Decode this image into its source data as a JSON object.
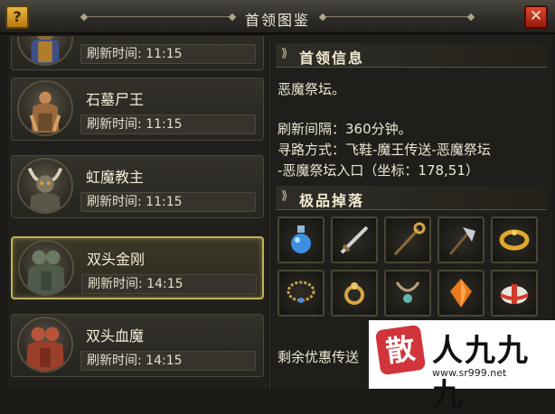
{
  "window": {
    "title": "首领图鉴",
    "help_label": "?",
    "close_label": "✕"
  },
  "boss_list": [
    {
      "name": "",
      "refresh_label": "刷新时间: 11:15",
      "portrait": "armored-boss-portrait",
      "selected": false
    },
    {
      "name": "石墓尸王",
      "refresh_label": "刷新时间: 11:15",
      "portrait": "tomb-king-portrait",
      "selected": false
    },
    {
      "name": "虹魔教主",
      "refresh_label": "刷新时间: 11:15",
      "portrait": "horned-demon-portrait",
      "selected": false
    },
    {
      "name": "双头金刚",
      "refresh_label": "刷新时间: 14:15",
      "portrait": "two-headed-giant-portrait",
      "selected": true
    },
    {
      "name": "双头血魔",
      "refresh_label": "刷新时间: 14:15",
      "portrait": "blood-demon-portrait",
      "selected": false
    }
  ],
  "boss_info": {
    "heading": "首领信息",
    "location": "恶魔祭坛。",
    "interval": "刷新间隔：360分钟。",
    "route_line1": "寻路方式：飞鞋-魔王传送-恶魔祭坛",
    "route_line2": "-恶魔祭坛入口（坐标：178,51）"
  },
  "drops": {
    "heading": "极品掉落",
    "items": [
      "blue-potion-icon",
      "sword-icon",
      "staff-icon",
      "axe-icon",
      "gold-bracelet-icon",
      "necklace-icon",
      "ring-icon",
      "amulet-icon",
      "orange-gem-icon",
      "gift-box-icon"
    ]
  },
  "footer": {
    "discount_text": "剩余优惠传送"
  },
  "watermark": {
    "seal": "散",
    "text": "人九九九",
    "url": "www.sr999.net"
  },
  "colors": {
    "selected_border": "#bdb35a",
    "close_button": "#c7321c",
    "help_button": "#d79f2e"
  }
}
